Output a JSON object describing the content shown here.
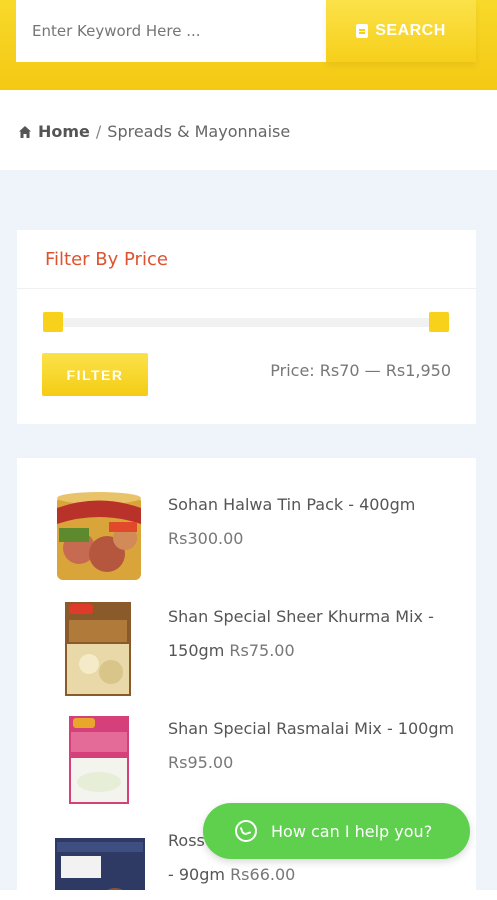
{
  "header": {
    "search_placeholder": "Enter Keyword Here ...",
    "search_label": "SEARCH",
    "accent_color": "#f6cf1a"
  },
  "breadcrumb": {
    "home": "Home",
    "separator": "/",
    "current": "Spreads & Mayonnaise"
  },
  "filter": {
    "title": "Filter By Price",
    "button_label": "FILTER",
    "price_text": "Price: Rs70 — Rs1,950",
    "range_min_fraction": 0,
    "range_max_fraction": 1,
    "title_color": "#e0512f"
  },
  "products": [
    {
      "name": "Sohan Halwa Tin Pack - 400gm",
      "price": "Rs300.00"
    },
    {
      "name": "Shan Special Sheer Khurma Mix - 150gm",
      "price": "Rs75.00"
    },
    {
      "name": "Shan Special Rasmalai Mix - 100gm",
      "price": "Rs95.00"
    },
    {
      "name_visible": "Ross",
      "name_line2": "- 90gm",
      "price": "Rs66.00"
    }
  ],
  "whatsapp": {
    "label": "How can I help you?",
    "color": "#5ed04e"
  }
}
